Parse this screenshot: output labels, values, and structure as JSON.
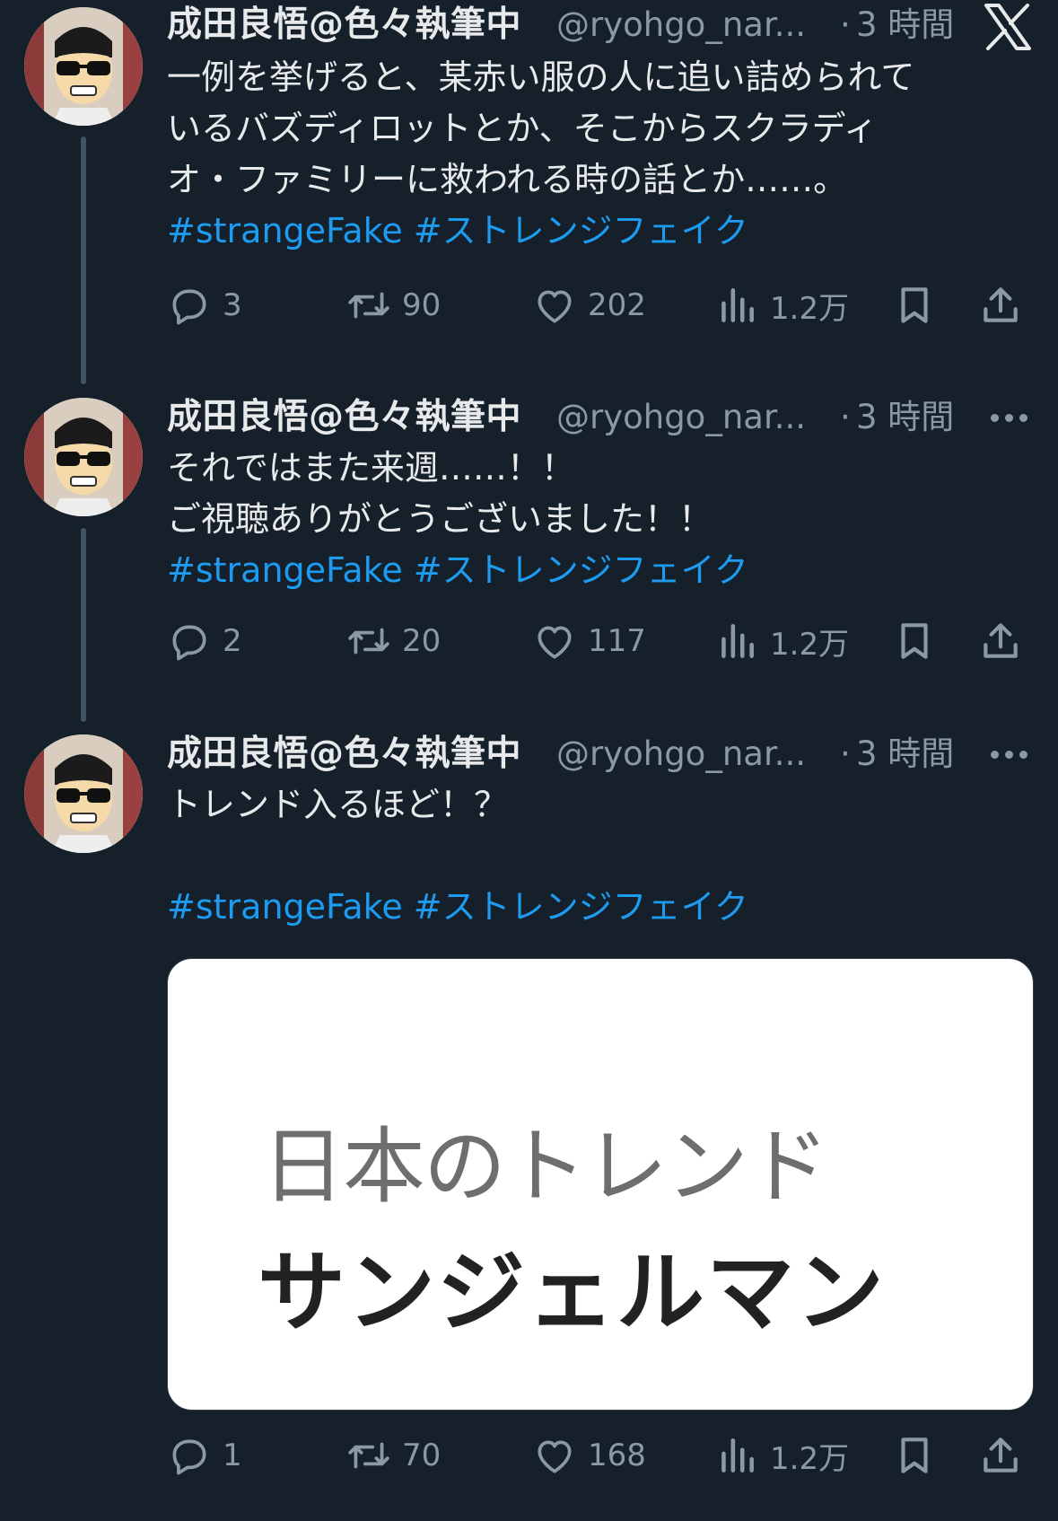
{
  "tweets": [
    {
      "author": "成田良悟@色々執筆中",
      "handle": "@ryohgo_nar...",
      "separator": "·",
      "time": "3 時間",
      "lines": [
        "一例を挙げると、某赤い服の人に追い詰められて",
        "いるバズディロットとか、そこからスクラディ",
        "オ・ファミリーに救われる時の話とか……。"
      ],
      "hashtags": "#strangeFake #ストレンジフェイク",
      "replies": "3",
      "reposts": "90",
      "likes": "202",
      "views": "1.2万"
    },
    {
      "author": "成田良悟@色々執筆中",
      "handle": "@ryohgo_nar...",
      "separator": "·",
      "time": "3 時間",
      "lines": [
        "それではまた来週……！！",
        "ご視聴ありがとうございました！！"
      ],
      "hashtags": "#strangeFake #ストレンジフェイク",
      "replies": "2",
      "reposts": "20",
      "likes": "117",
      "views": "1.2万"
    },
    {
      "author": "成田良悟@色々執筆中",
      "handle": "@ryohgo_nar...",
      "separator": "·",
      "time": "3 時間",
      "lines": [
        "トレンド入るほど！？"
      ],
      "hashtags": "#strangeFake #ストレンジフェイク",
      "media": {
        "line1": "日本のトレンド",
        "line2": "サンジェルマン"
      },
      "replies": "1",
      "reposts": "70",
      "likes": "168",
      "views": "1.2万"
    }
  ],
  "icons": {
    "brand": "x-logo-icon",
    "reply": "reply-icon",
    "repost": "repost-icon",
    "like": "heart-icon",
    "views": "views-icon",
    "bookmark": "bookmark-icon",
    "share": "share-icon",
    "more": "more-icon"
  },
  "colors": {
    "background": "#15202b",
    "text": "#e7e9ea",
    "muted": "#8b98a5",
    "link": "#1d9bf0"
  }
}
